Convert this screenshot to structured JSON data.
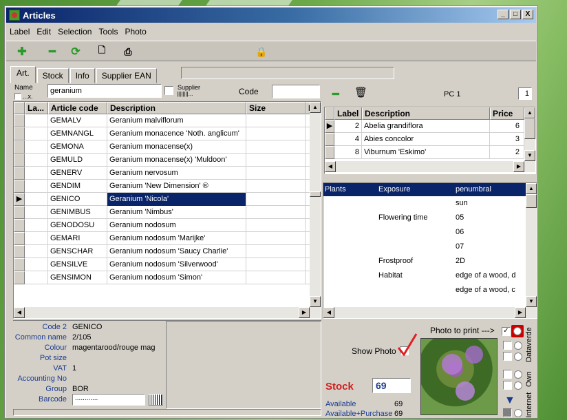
{
  "window": {
    "title": "Articles",
    "min": "_",
    "max": "□",
    "close": "X"
  },
  "menu": [
    "Label",
    "Edit",
    "Selection",
    "Tools",
    "Photo"
  ],
  "tabs": [
    "Art.",
    "Stock",
    "Info",
    "Supplier EAN"
  ],
  "search": {
    "name_label": "Name",
    "name_sub": "...x.",
    "name_value": "geranium",
    "supplier_label": "Supplier",
    "supplier_sub": "||||||||...",
    "code_label": "Code",
    "code_value": ""
  },
  "articles": {
    "headers": [
      "La...",
      "Article code",
      "Description",
      "Size",
      "F"
    ],
    "rows": [
      [
        "GEMALV",
        "Geranium malviflorum"
      ],
      [
        "GEMNANGL",
        "Geranium monacence 'Noth. anglicum'"
      ],
      [
        "GEMONA",
        "Geranium monacense(x)"
      ],
      [
        "GEMULD",
        "Geranium monacense(x) 'Muldoon'"
      ],
      [
        "GENERV",
        "Geranium nervosum"
      ],
      [
        "GENDIM",
        "Geranium 'New Dimension' ®"
      ],
      [
        "GENICO",
        "Geranium 'Nicola'"
      ],
      [
        "GENIMBUS",
        "Geranium 'Nimbus'"
      ],
      [
        "GENODOSU",
        "Geranium nodosum"
      ],
      [
        "GEMARI",
        "Geranium nodosum 'Marijke'"
      ],
      [
        "GENSCHAR",
        "Geranium nodosum 'Saucy Charlie'"
      ],
      [
        "GENSILVE",
        "Geranium nodosum 'Silverwood'"
      ],
      [
        "GENSIMON",
        "Geranium nodosum 'Simon'"
      ]
    ],
    "selected_index": 6
  },
  "labels": {
    "pc_label": "PC 1",
    "pc_value": "1",
    "headers": [
      "Label",
      "Description",
      "Price"
    ],
    "rows": [
      [
        "2",
        "Abelia grandiflora",
        "6"
      ],
      [
        "4",
        "Abies concolor",
        "3"
      ],
      [
        "8",
        "Viburnum 'Eskimo'",
        "2"
      ]
    ]
  },
  "properties": {
    "headers": [
      "Plants",
      "Exposure",
      "penumbral"
    ],
    "rows": [
      [
        "",
        "",
        "sun"
      ],
      [
        "",
        "Flowering time",
        "05"
      ],
      [
        "",
        "",
        "06"
      ],
      [
        "",
        "",
        "07"
      ],
      [
        "",
        "Frostproof",
        "2D"
      ],
      [
        "",
        "Habitat",
        "edge of a wood, d"
      ],
      [
        "",
        "",
        "edge of a wood, c"
      ]
    ]
  },
  "details": {
    "code2_label": "Code 2",
    "code2": "GENICO",
    "common_label": "Common name",
    "common": "2/105",
    "colour_label": "Colour",
    "colour": "magentarood/rouge mag",
    "pot_label": "Pot size",
    "pot": "",
    "vat_label": "VAT",
    "vat": "1",
    "acc_label": "Accounting No",
    "acc": "",
    "group_label": "Group",
    "group": "BOR",
    "barcode_label": "Barcode",
    "barcode": "............"
  },
  "photo": {
    "print_label": "Photo to print --->",
    "show_label": "Show Photo",
    "side1": "Dataverde",
    "side2": "Own",
    "side3": "Internet"
  },
  "stock": {
    "label": "Stock",
    "value": "69",
    "available_label": "Available",
    "available": "69",
    "avail_purchase_label": "Available+Purchase",
    "avail_purchase": "69"
  },
  "colors": {
    "stock_red": "#d02020",
    "label_blue": "#1b3b8f",
    "selection": "#0a246a"
  }
}
